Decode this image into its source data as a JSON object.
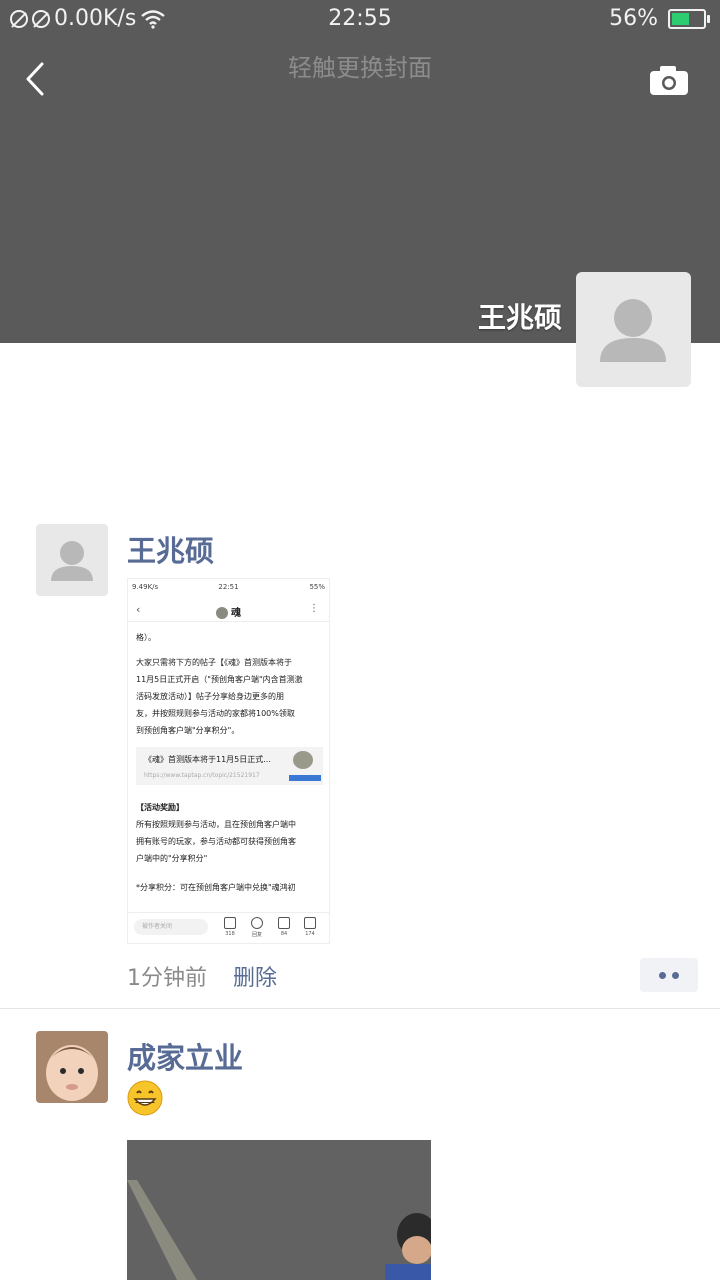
{
  "status_bar": {
    "speed": "0.00K/s",
    "time": "22:55",
    "battery": "56%",
    "battery_level": 0.56
  },
  "cover": {
    "hint": "轻触更换封面",
    "user_name": "王兆硕"
  },
  "posts": [
    {
      "author": "王兆硕",
      "time": "1分钟前",
      "delete_label": "删除",
      "shared_screenshot": {
        "status_left": "9.49K/s",
        "status_time": "22:51",
        "status_battery": "55%",
        "title": "魂",
        "body_line0": "格）。",
        "body_lines": [
          "大家只需将下方的帖子【《魂》首测版本将于",
          "11月5日正式开启（\"预创角客户端\"内含首测激",
          "活码发放活动）】帖子分享给身边更多的朋",
          "友，并按照规则参与活动的家都将100%领取",
          "到预创角客户端\"分享积分\"。"
        ],
        "card_title": "《魂》首测版本将于11月5日正式...",
        "card_url": "https://www.taptap.cn/topic/21521917",
        "section_title": "【活动奖励】",
        "section_lines": [
          "所有按照规则参与活动，且在预创角客户端中",
          "拥有账号的玩家，参与活动都可获得预创角客",
          "户端中的\"分享积分\""
        ],
        "footer_line": "*分享积分：可在预创角客户端中兑换\"魂鸿初",
        "input_placeholder": "被作者关闭",
        "counts": [
          "318",
          "回复",
          "84",
          "174"
        ]
      }
    },
    {
      "author": "成家立业"
    }
  ]
}
